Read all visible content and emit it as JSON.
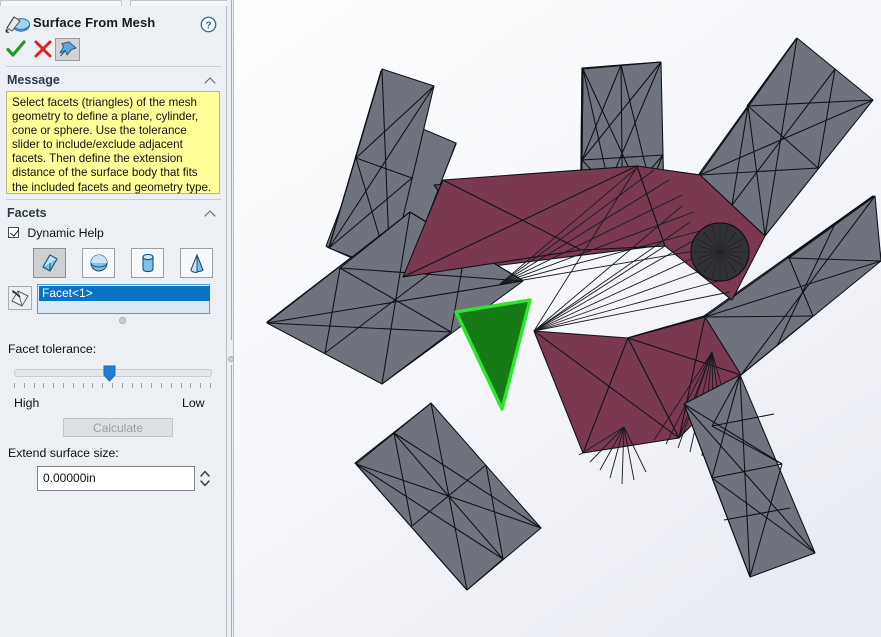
{
  "panel": {
    "title": "Surface From Mesh",
    "icon": "surface-from-mesh-icon",
    "help_icon": "help-icon",
    "actions": {
      "ok": "✓",
      "cancel": "✕",
      "pin": "pin-icon"
    },
    "sections": {
      "message": {
        "label": "Message",
        "collapse_icon": "chevron-up-icon",
        "text": "Select facets (triangles) of the mesh geometry to define a plane, cylinder, cone or sphere.  Use the tolerance slider to include/exclude adjacent facets.  Then define the extension distance of the surface body that fits the included facets and geometry type.",
        "background": "#ffff99"
      },
      "facets": {
        "label": "Facets",
        "collapse_icon": "chevron-up-icon",
        "dynamic_help": {
          "label": "Dynamic Help",
          "checked": true
        },
        "geometry_buttons": [
          {
            "name": "plane",
            "icon": "plane-icon",
            "selected": true
          },
          {
            "name": "sphere",
            "icon": "sphere-icon",
            "selected": false
          },
          {
            "name": "cylinder",
            "icon": "cylinder-icon",
            "selected": false
          },
          {
            "name": "cone",
            "icon": "cone-icon",
            "selected": false
          }
        ],
        "selection": {
          "icon": "facet-selection-icon",
          "items": [
            "Facet<1>"
          ]
        }
      }
    },
    "facet_tolerance": {
      "label": "Facet tolerance:",
      "min_label": "High",
      "max_label": "Low",
      "value_percent": 48,
      "tick_count": 21
    },
    "calculate_button": {
      "label": "Calculate",
      "enabled": false
    },
    "extend_surface": {
      "label": "Extend surface size:",
      "value": "0.00000in",
      "spinner_icon": "spinner-arrows-icon"
    }
  },
  "splitter": {
    "name": "panel-splitter",
    "grip_icon": "grip-dot-icon"
  },
  "viewport": {
    "name": "graphics-area",
    "background": "#f5f6fa",
    "mesh": {
      "face_color": "#6b707d",
      "selected_region_color": "#7a3950",
      "highlight_facet_fill": "#157a16",
      "highlight_facet_outline": "#22e022",
      "edge_color": "#13151a",
      "hole_color": "#2c2c30"
    }
  },
  "colors": {
    "panel_bg": "#eceff3",
    "accent_blue": "#0a72c3",
    "ok_green": "#1f9a2e",
    "cancel_red": "#dd2222",
    "message_yellow": "#ffff99"
  }
}
